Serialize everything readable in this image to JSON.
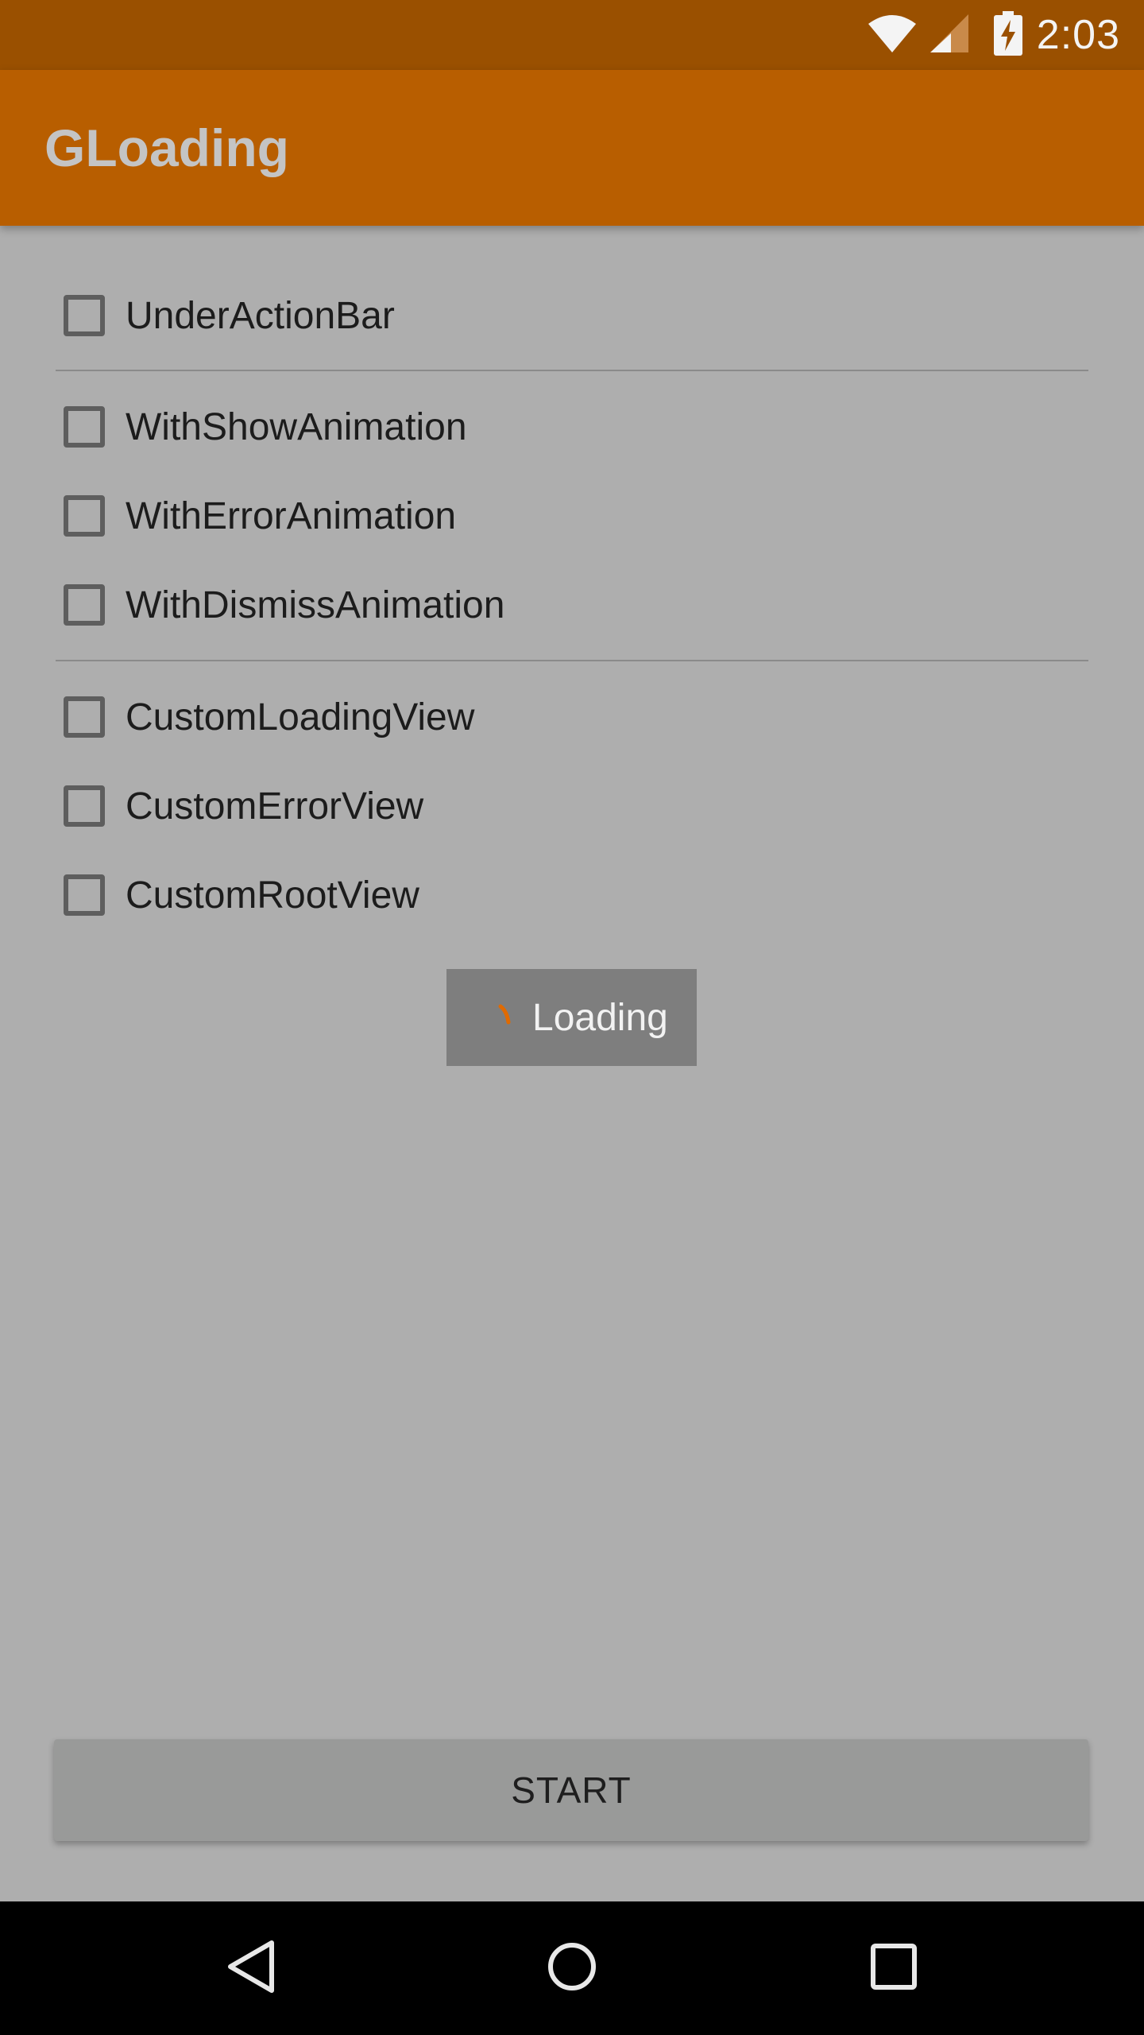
{
  "status_bar": {
    "time": "2:03",
    "icons": [
      "wifi-icon",
      "cell-signal-icon",
      "battery-charging-icon"
    ]
  },
  "app_bar": {
    "title": "GLoading"
  },
  "options": {
    "group1": [
      {
        "label": "UnderActionBar",
        "checked": false
      }
    ],
    "group2": [
      {
        "label": "WithShowAnimation",
        "checked": false
      },
      {
        "label": "WithErrorAnimation",
        "checked": false
      },
      {
        "label": "WithDismissAnimation",
        "checked": false
      }
    ],
    "group3": [
      {
        "label": "CustomLoadingView",
        "checked": false
      },
      {
        "label": "CustomErrorView",
        "checked": false
      },
      {
        "label": "CustomRootView",
        "checked": false
      }
    ]
  },
  "loading": {
    "text": "Loading",
    "spinner_color": "#e06a00"
  },
  "start_button": {
    "label": "START"
  },
  "nav_bar": {
    "icons": [
      "back-icon",
      "home-icon",
      "recents-icon"
    ]
  },
  "colors": {
    "status_bar": "#9a5000",
    "app_bar": "#b85e00",
    "background": "#aeaeae"
  }
}
